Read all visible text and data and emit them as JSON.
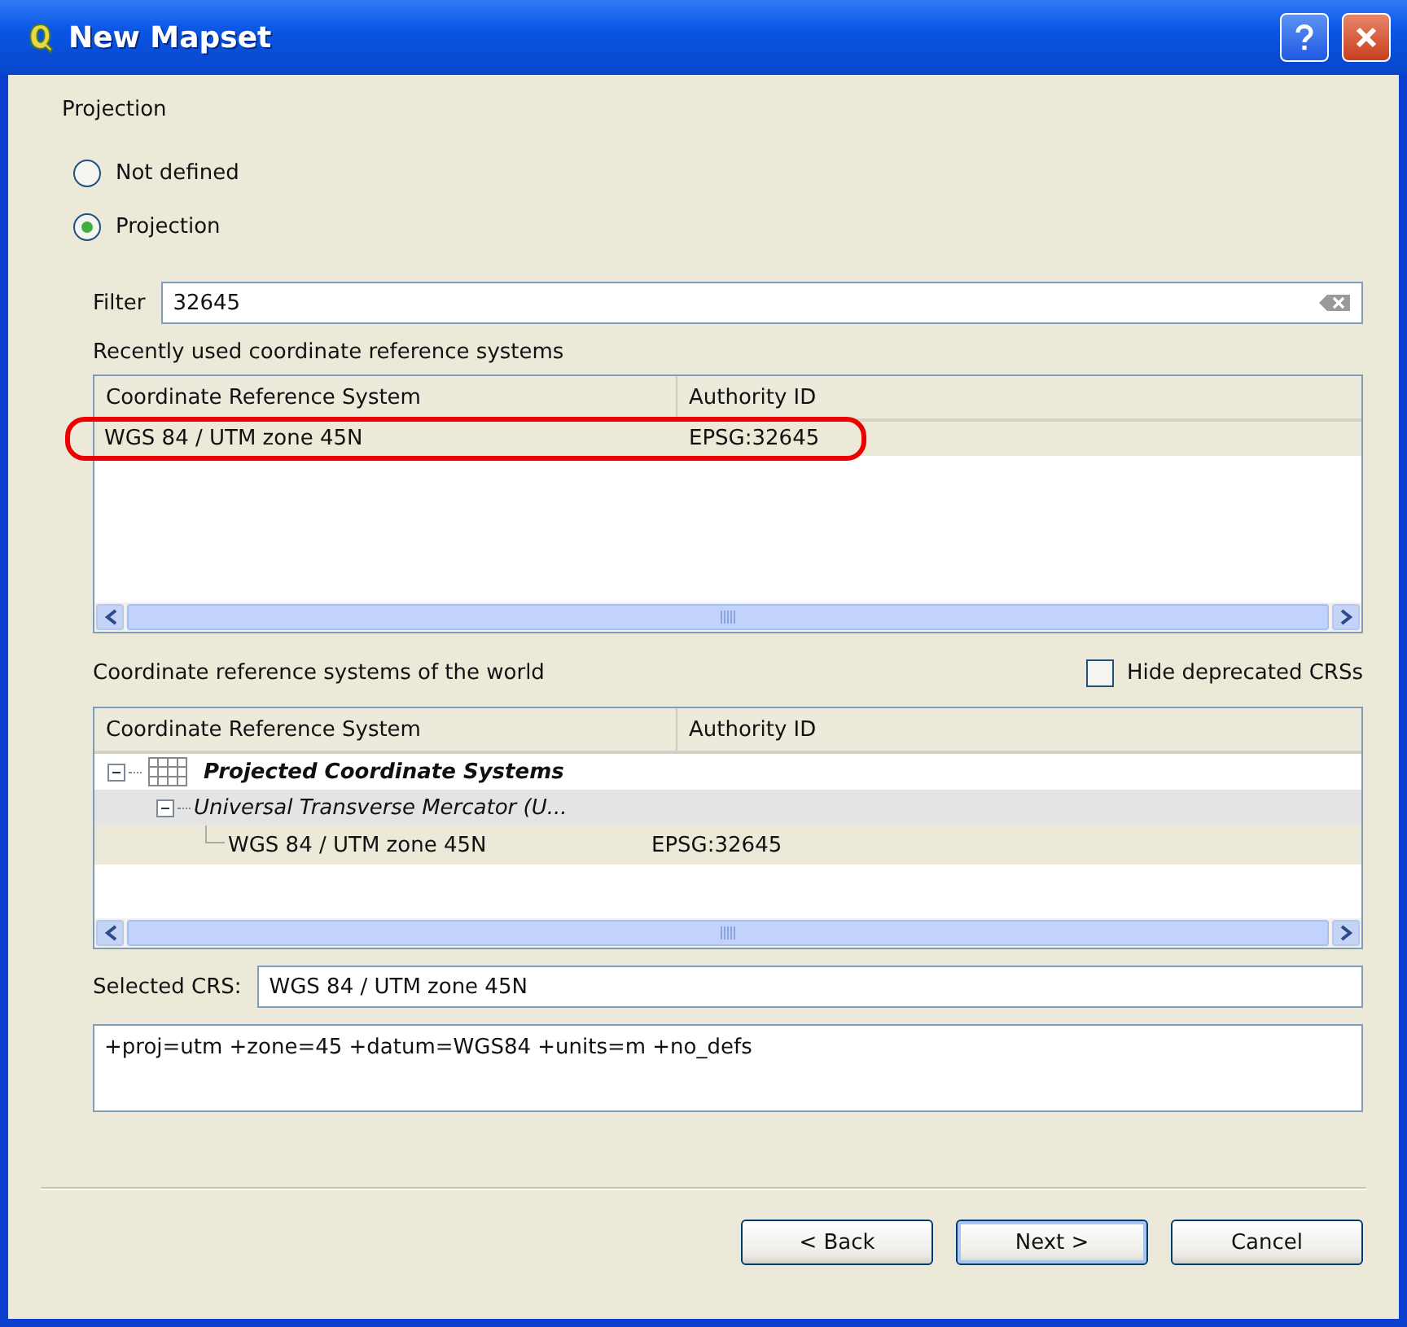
{
  "window": {
    "title": "New Mapset"
  },
  "section_title": "Projection",
  "projection_options": [
    {
      "label": "Not defined",
      "selected": false
    },
    {
      "label": "Projection",
      "selected": true
    }
  ],
  "filter": {
    "label": "Filter",
    "value": "32645"
  },
  "recent": {
    "title": "Recently used coordinate reference systems",
    "columns": [
      "Coordinate Reference System",
      "Authority ID"
    ],
    "rows": [
      {
        "name": "WGS 84 / UTM zone 45N",
        "authority_id": "EPSG:32645",
        "selected": true,
        "highlighted": true
      }
    ]
  },
  "world": {
    "title": "Coordinate reference systems of the world",
    "hide_deprecated": {
      "label": "Hide deprecated CRSs",
      "checked": false
    },
    "columns": [
      "Coordinate Reference System",
      "Authority ID"
    ],
    "tree": [
      {
        "name": "Projected Coordinate Systems",
        "kind": "group",
        "expanded": true,
        "children": [
          {
            "name": "Universal Transverse Mercator (U...",
            "kind": "subgroup",
            "expanded": true,
            "children": [
              {
                "name": "WGS 84 / UTM zone 45N",
                "kind": "crs",
                "authority_id": "EPSG:32645",
                "selected": true
              }
            ]
          }
        ]
      }
    ]
  },
  "selected_crs": {
    "label": "Selected CRS:",
    "value": "WGS 84 / UTM zone 45N"
  },
  "proj_string": "+proj=utm +zone=45 +datum=WGS84 +units=m +no_defs",
  "buttons": [
    {
      "label": "< Back",
      "default": false
    },
    {
      "label": "Next >",
      "default": true
    },
    {
      "label": "Cancel",
      "default": false
    }
  ]
}
